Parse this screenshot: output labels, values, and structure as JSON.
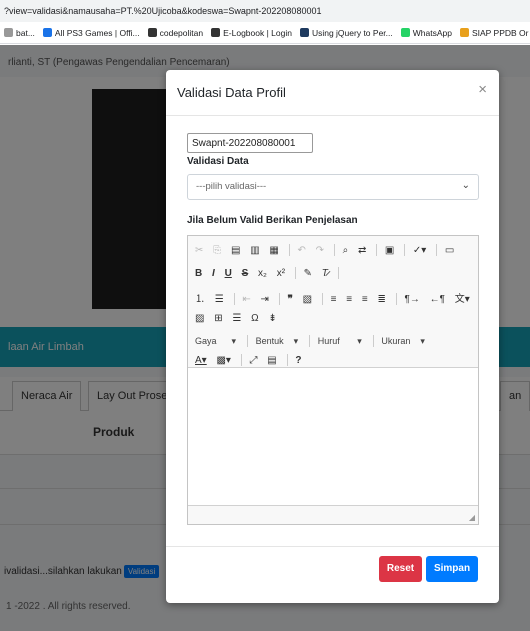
{
  "browser": {
    "url": "?view=validasi&namausaha=PT.%20Ujicoba&kodeswa=Swapnt-202208080001",
    "bookmarks": [
      {
        "label": "bat...",
        "color": "#999999"
      },
      {
        "label": "All PS3 Games | Offi...",
        "color": "#1a73e8"
      },
      {
        "label": "codepolitan",
        "color": "#333333"
      },
      {
        "label": "E-Logbook | Login",
        "color": "#333333"
      },
      {
        "label": "Using jQuery to Per...",
        "color": "#1e3a5f"
      },
      {
        "label": "WhatsApp",
        "color": "#25d366"
      },
      {
        "label": "SIAP PPDB Or",
        "color": "#e8a01c"
      }
    ]
  },
  "page": {
    "user_line": "rlianti, ST (Pengawas Pengendalian Pencemaran)",
    "section_title": "laan Air Limbah",
    "tabs": [
      "Neraca Air",
      "Lay Out Prose",
      "an"
    ],
    "table_header": "Produk",
    "notice_text": "ivalidasi...silahkan lakukan",
    "notice_button": "Validasi",
    "footer": "1 -2022 . All rights reserved."
  },
  "modal": {
    "title": "Validasi Data Profil",
    "close_glyph": "×",
    "kode_value": "Swapnt-202208080001",
    "validasi_label": "Validasi Data",
    "select_value": "---pilih validasi---",
    "penjelasan_label": "Jila Belum Valid Berikan Penjelasan",
    "toolbar": {
      "combo_style": "Gaya",
      "combo_format": "Bentuk",
      "combo_font": "Huruf",
      "combo_size": "Ukuran"
    },
    "reset_label": "Reset",
    "save_label": "Simpan"
  }
}
